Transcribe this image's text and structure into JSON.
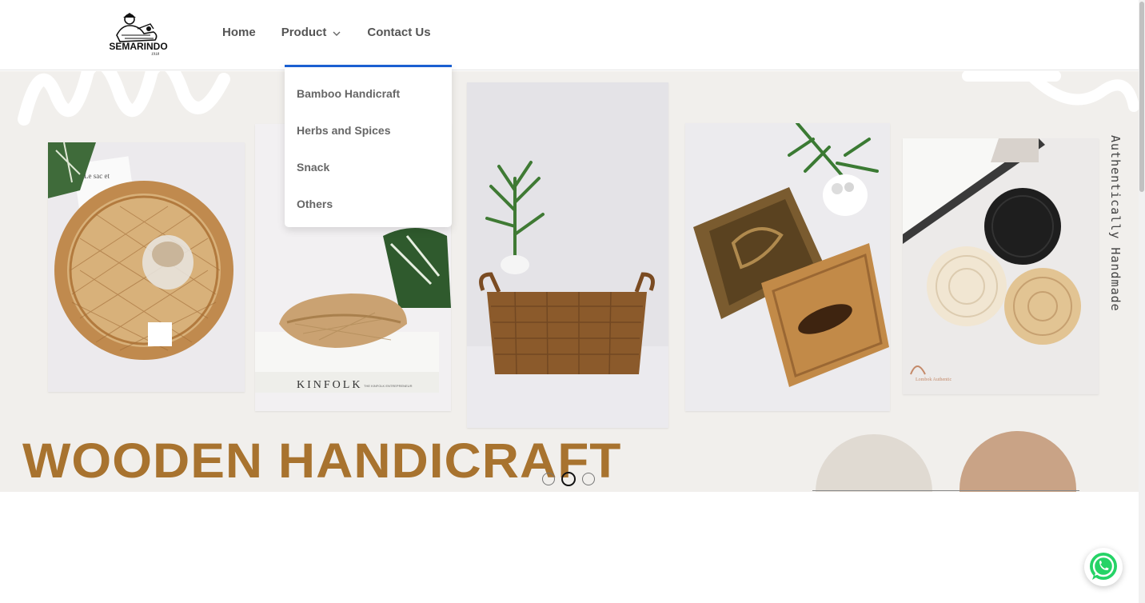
{
  "brand": {
    "logo_text": "SEMARINDO",
    "logo_tagline": "1918"
  },
  "nav": {
    "home": "Home",
    "product": "Product",
    "contact": "Contact Us"
  },
  "dropdown": {
    "items": [
      "Bamboo Handicraft",
      "Herbs and Spices",
      "Snack",
      "Others"
    ]
  },
  "hero": {
    "headline": "WOODEN HANDICRAFT",
    "side_text": "Authentically Handmade",
    "photo_text": {
      "card_book": "Le sac et",
      "kinfolk_book": "KINFOLK",
      "kinfolk_spine": "THE KINFOLK ENTREPRENEUR",
      "coaster_brand": "Lombok Authentic"
    },
    "colors": {
      "headline": "#a8732f",
      "background": "#f1efec",
      "circle_light": "#e0dad2",
      "circle_tan": "#c9a386"
    }
  },
  "carousel": {
    "slide_count": 3,
    "active_index": 1
  },
  "icons": {
    "chevron": "chevron-down-icon",
    "whatsapp": "whatsapp-icon"
  },
  "colors": {
    "accent": "#1a5fd1",
    "whatsapp": "#25d366"
  }
}
